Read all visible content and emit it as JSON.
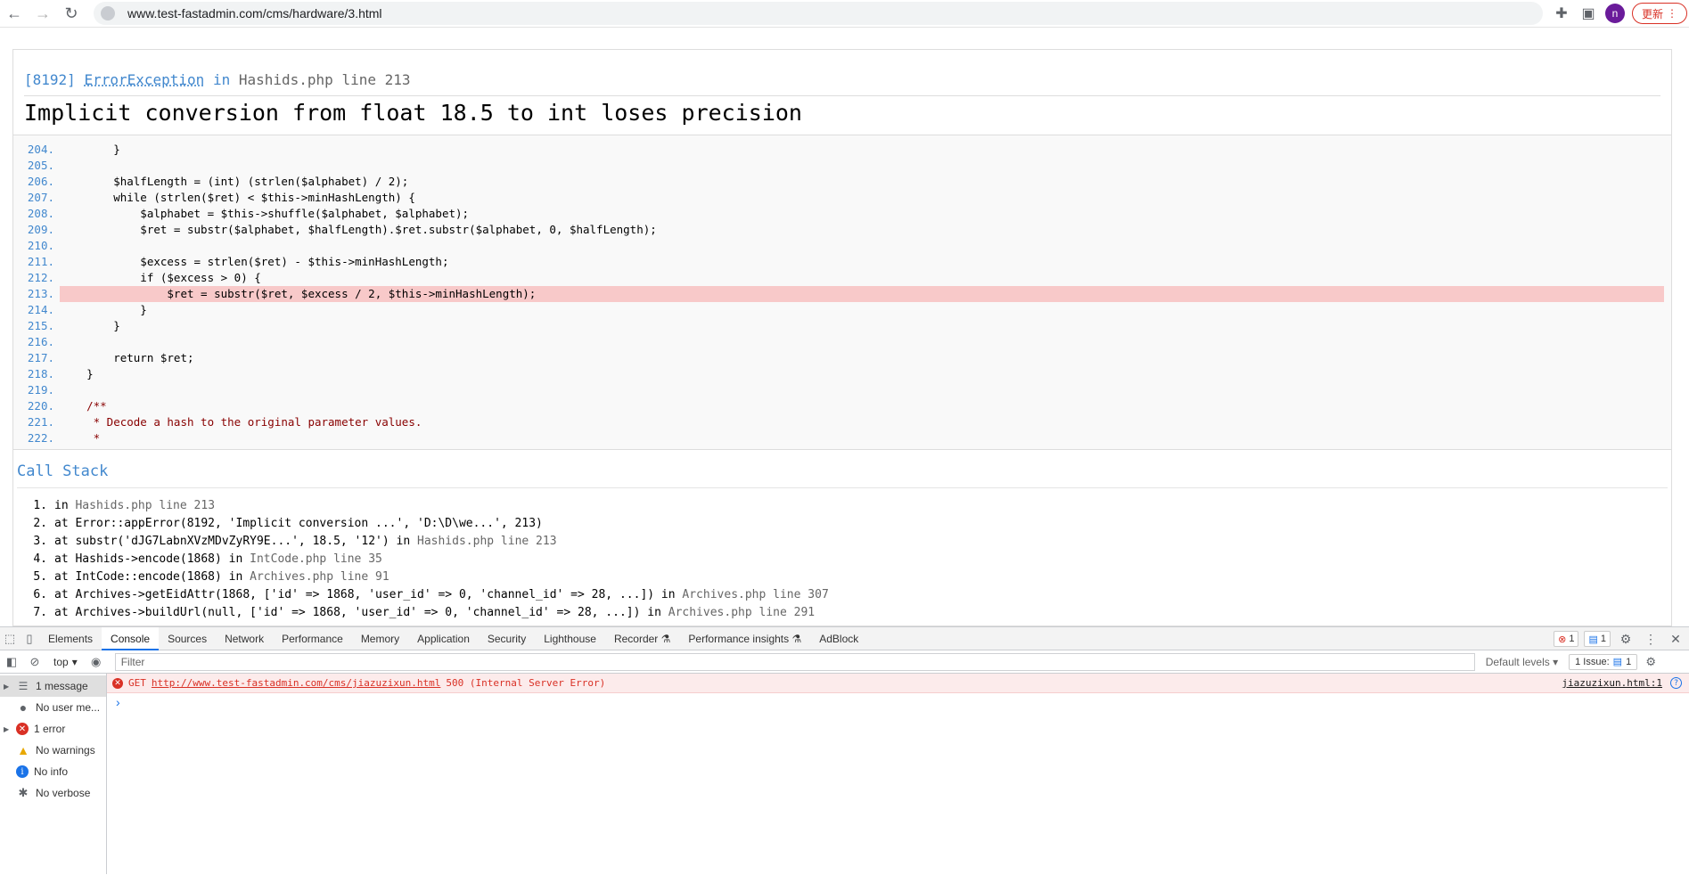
{
  "browser": {
    "url": "www.test-fastadmin.com/cms/hardware/3.html",
    "profile_initial": "n",
    "update_label": "更新"
  },
  "error": {
    "code": "[8192]",
    "exception_class": "ErrorException",
    "in_word": "in",
    "location": "Hashids.php line 213",
    "message": "Implicit conversion from float 18.5 to int loses precision"
  },
  "source": {
    "lines": [
      {
        "num": "204.",
        "code": "        }"
      },
      {
        "num": "205.",
        "code": ""
      },
      {
        "num": "206.",
        "code": "        $halfLength = (int) (strlen($alphabet) / 2);"
      },
      {
        "num": "207.",
        "code": "        while (strlen($ret) < $this->minHashLength) {"
      },
      {
        "num": "208.",
        "code": "            $alphabet = $this->shuffle($alphabet, $alphabet);"
      },
      {
        "num": "209.",
        "code": "            $ret = substr($alphabet, $halfLength).$ret.substr($alphabet, 0, $halfLength);"
      },
      {
        "num": "210.",
        "code": ""
      },
      {
        "num": "211.",
        "code": "            $excess = strlen($ret) - $this->minHashLength;"
      },
      {
        "num": "212.",
        "code": "            if ($excess > 0) {"
      },
      {
        "num": "213.",
        "code": "                $ret = substr($ret, $excess / 2, $this->minHashLength);"
      },
      {
        "num": "214.",
        "code": "            }"
      },
      {
        "num": "215.",
        "code": "        }"
      },
      {
        "num": "216.",
        "code": ""
      },
      {
        "num": "217.",
        "code": "        return $ret;"
      },
      {
        "num": "218.",
        "code": "    }"
      },
      {
        "num": "219.",
        "code": ""
      },
      {
        "num": "220.",
        "code": "    /**"
      },
      {
        "num": "221.",
        "code": "     * Decode a hash to the original parameter values."
      },
      {
        "num": "222.",
        "code": "     *"
      }
    ],
    "highlight_line": "213."
  },
  "callstack": {
    "title": "Call Stack",
    "items": [
      {
        "idx": "1.",
        "text": "in ",
        "loc": "Hashids.php line 213"
      },
      {
        "idx": "2.",
        "text": "at Error::appError(8192, 'Implicit conversion ...', 'D:\\D\\we...', 213)",
        "loc": ""
      },
      {
        "idx": "3.",
        "text": "at substr('dJG7LabnXVzMDvZyRY9E...', 18.5, '12') in ",
        "loc": "Hashids.php line 213"
      },
      {
        "idx": "4.",
        "text": "at Hashids->encode(1868) in ",
        "loc": "IntCode.php line 35"
      },
      {
        "idx": "5.",
        "text": "at IntCode::encode(1868) in ",
        "loc": "Archives.php line 91"
      },
      {
        "idx": "6.",
        "text": "at Archives->getEidAttr(1868, ['id' => 1868, 'user_id' => 0, 'channel_id' => 28, ...]) in ",
        "loc": "Archives.php line 307"
      },
      {
        "idx": "7.",
        "text": "at Archives->buildUrl(null, ['id' => 1868, 'user_id' => 0, 'channel_id' => 28, ...]) in ",
        "loc": "Archives.php line 291"
      }
    ]
  },
  "devtools": {
    "tabs": [
      "Elements",
      "Console",
      "Sources",
      "Network",
      "Performance",
      "Memory",
      "Application",
      "Security",
      "Lighthouse",
      "Recorder ⚗",
      "Performance insights ⚗",
      "AdBlock"
    ],
    "active_tab": "Console",
    "error_count": "1",
    "message_count": "1",
    "context": "top",
    "filter_placeholder": "Filter",
    "levels_label": "Default levels ▾",
    "issues_label": "1 Issue:",
    "issues_count": "1",
    "sidebar": [
      {
        "label": "1 message",
        "icon": "list-icon"
      },
      {
        "label": "No user me...",
        "icon": "user-icon"
      },
      {
        "label": "1 error",
        "icon": "error-icon"
      },
      {
        "label": "No warnings",
        "icon": "warning-icon"
      },
      {
        "label": "No info",
        "icon": "info-icon"
      },
      {
        "label": "No verbose",
        "icon": "verbose-icon"
      }
    ],
    "console_message": {
      "method": "GET",
      "url": "http://www.test-fastadmin.com/cms/jiazuzixun.html",
      "status": "500 (Internal Server Error)",
      "source": "jiazuzixun.html:1"
    }
  }
}
